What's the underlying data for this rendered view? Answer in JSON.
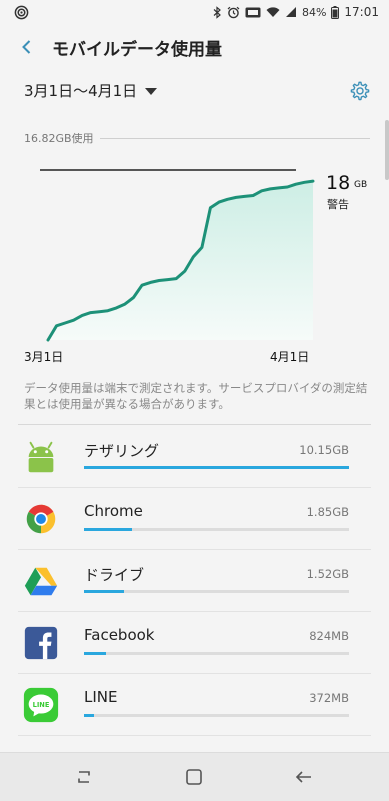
{
  "status_bar": {
    "battery": "84%",
    "time": "17:01",
    "icons": [
      "app-notification-icon",
      "bluetooth-icon",
      "alarm-icon",
      "volte-icon",
      "wifi-icon",
      "signal-icon",
      "battery-icon"
    ]
  },
  "header": {
    "title": "モバイルデータ使用量",
    "back_icon": "back-arrow-icon"
  },
  "date_range": {
    "label": "3月1日〜4月1日",
    "settings_icon": "gear-icon"
  },
  "chart": {
    "usage_label": "16.82GB使用",
    "warning_value": "18",
    "warning_unit": "GB",
    "warning_label": "警告",
    "x_start": "3月1日",
    "x_end": "4月1日"
  },
  "chart_data": {
    "type": "area",
    "title": "16.82GB使用",
    "x": [
      1,
      2,
      3,
      4,
      5,
      6,
      7,
      8,
      9,
      10,
      11,
      12,
      13,
      14,
      15,
      16,
      17,
      18,
      19,
      20,
      21,
      22,
      23,
      24,
      25,
      26,
      27,
      28,
      29,
      30,
      31,
      32
    ],
    "y": [
      0.0,
      1.5,
      1.8,
      2.1,
      2.6,
      2.9,
      3.0,
      3.1,
      3.4,
      3.8,
      4.5,
      5.8,
      6.1,
      6.3,
      6.4,
      6.5,
      7.3,
      8.8,
      9.8,
      14.0,
      14.6,
      14.9,
      15.1,
      15.2,
      15.3,
      15.8,
      16.0,
      16.1,
      16.2,
      16.5,
      16.7,
      16.82
    ],
    "x_tick_labels": [
      "3月1日",
      "4月1日"
    ],
    "ylim": [
      0,
      18
    ],
    "warning_line": 18,
    "warning_label": "警告",
    "color": "#1d9178"
  },
  "note": "データ使用量は端末で測定されます。サービスプロバイダの測定結果とは使用量が異なる場合があります。",
  "apps": [
    {
      "name": "テザリング",
      "usage": "10.15GB",
      "usage_gb": 10.15,
      "icon": "android-icon"
    },
    {
      "name": "Chrome",
      "usage": "1.85GB",
      "usage_gb": 1.85,
      "icon": "chrome-icon"
    },
    {
      "name": "ドライブ",
      "usage": "1.52GB",
      "usage_gb": 1.52,
      "icon": "google-drive-icon"
    },
    {
      "name": "Facebook",
      "usage": "824MB",
      "usage_gb": 0.824,
      "icon": "facebook-icon"
    },
    {
      "name": "LINE",
      "usage": "372MB",
      "usage_gb": 0.372,
      "icon": "line-icon"
    }
  ],
  "nav": {
    "recents_icon": "recent-apps-icon",
    "home_icon": "home-icon",
    "back_icon": "back-icon"
  },
  "colors": {
    "accent": "#2aa7de",
    "chart_line": "#1d9178",
    "chart_fill": "#d3efe7",
    "header_icon": "#3a8fb7"
  }
}
